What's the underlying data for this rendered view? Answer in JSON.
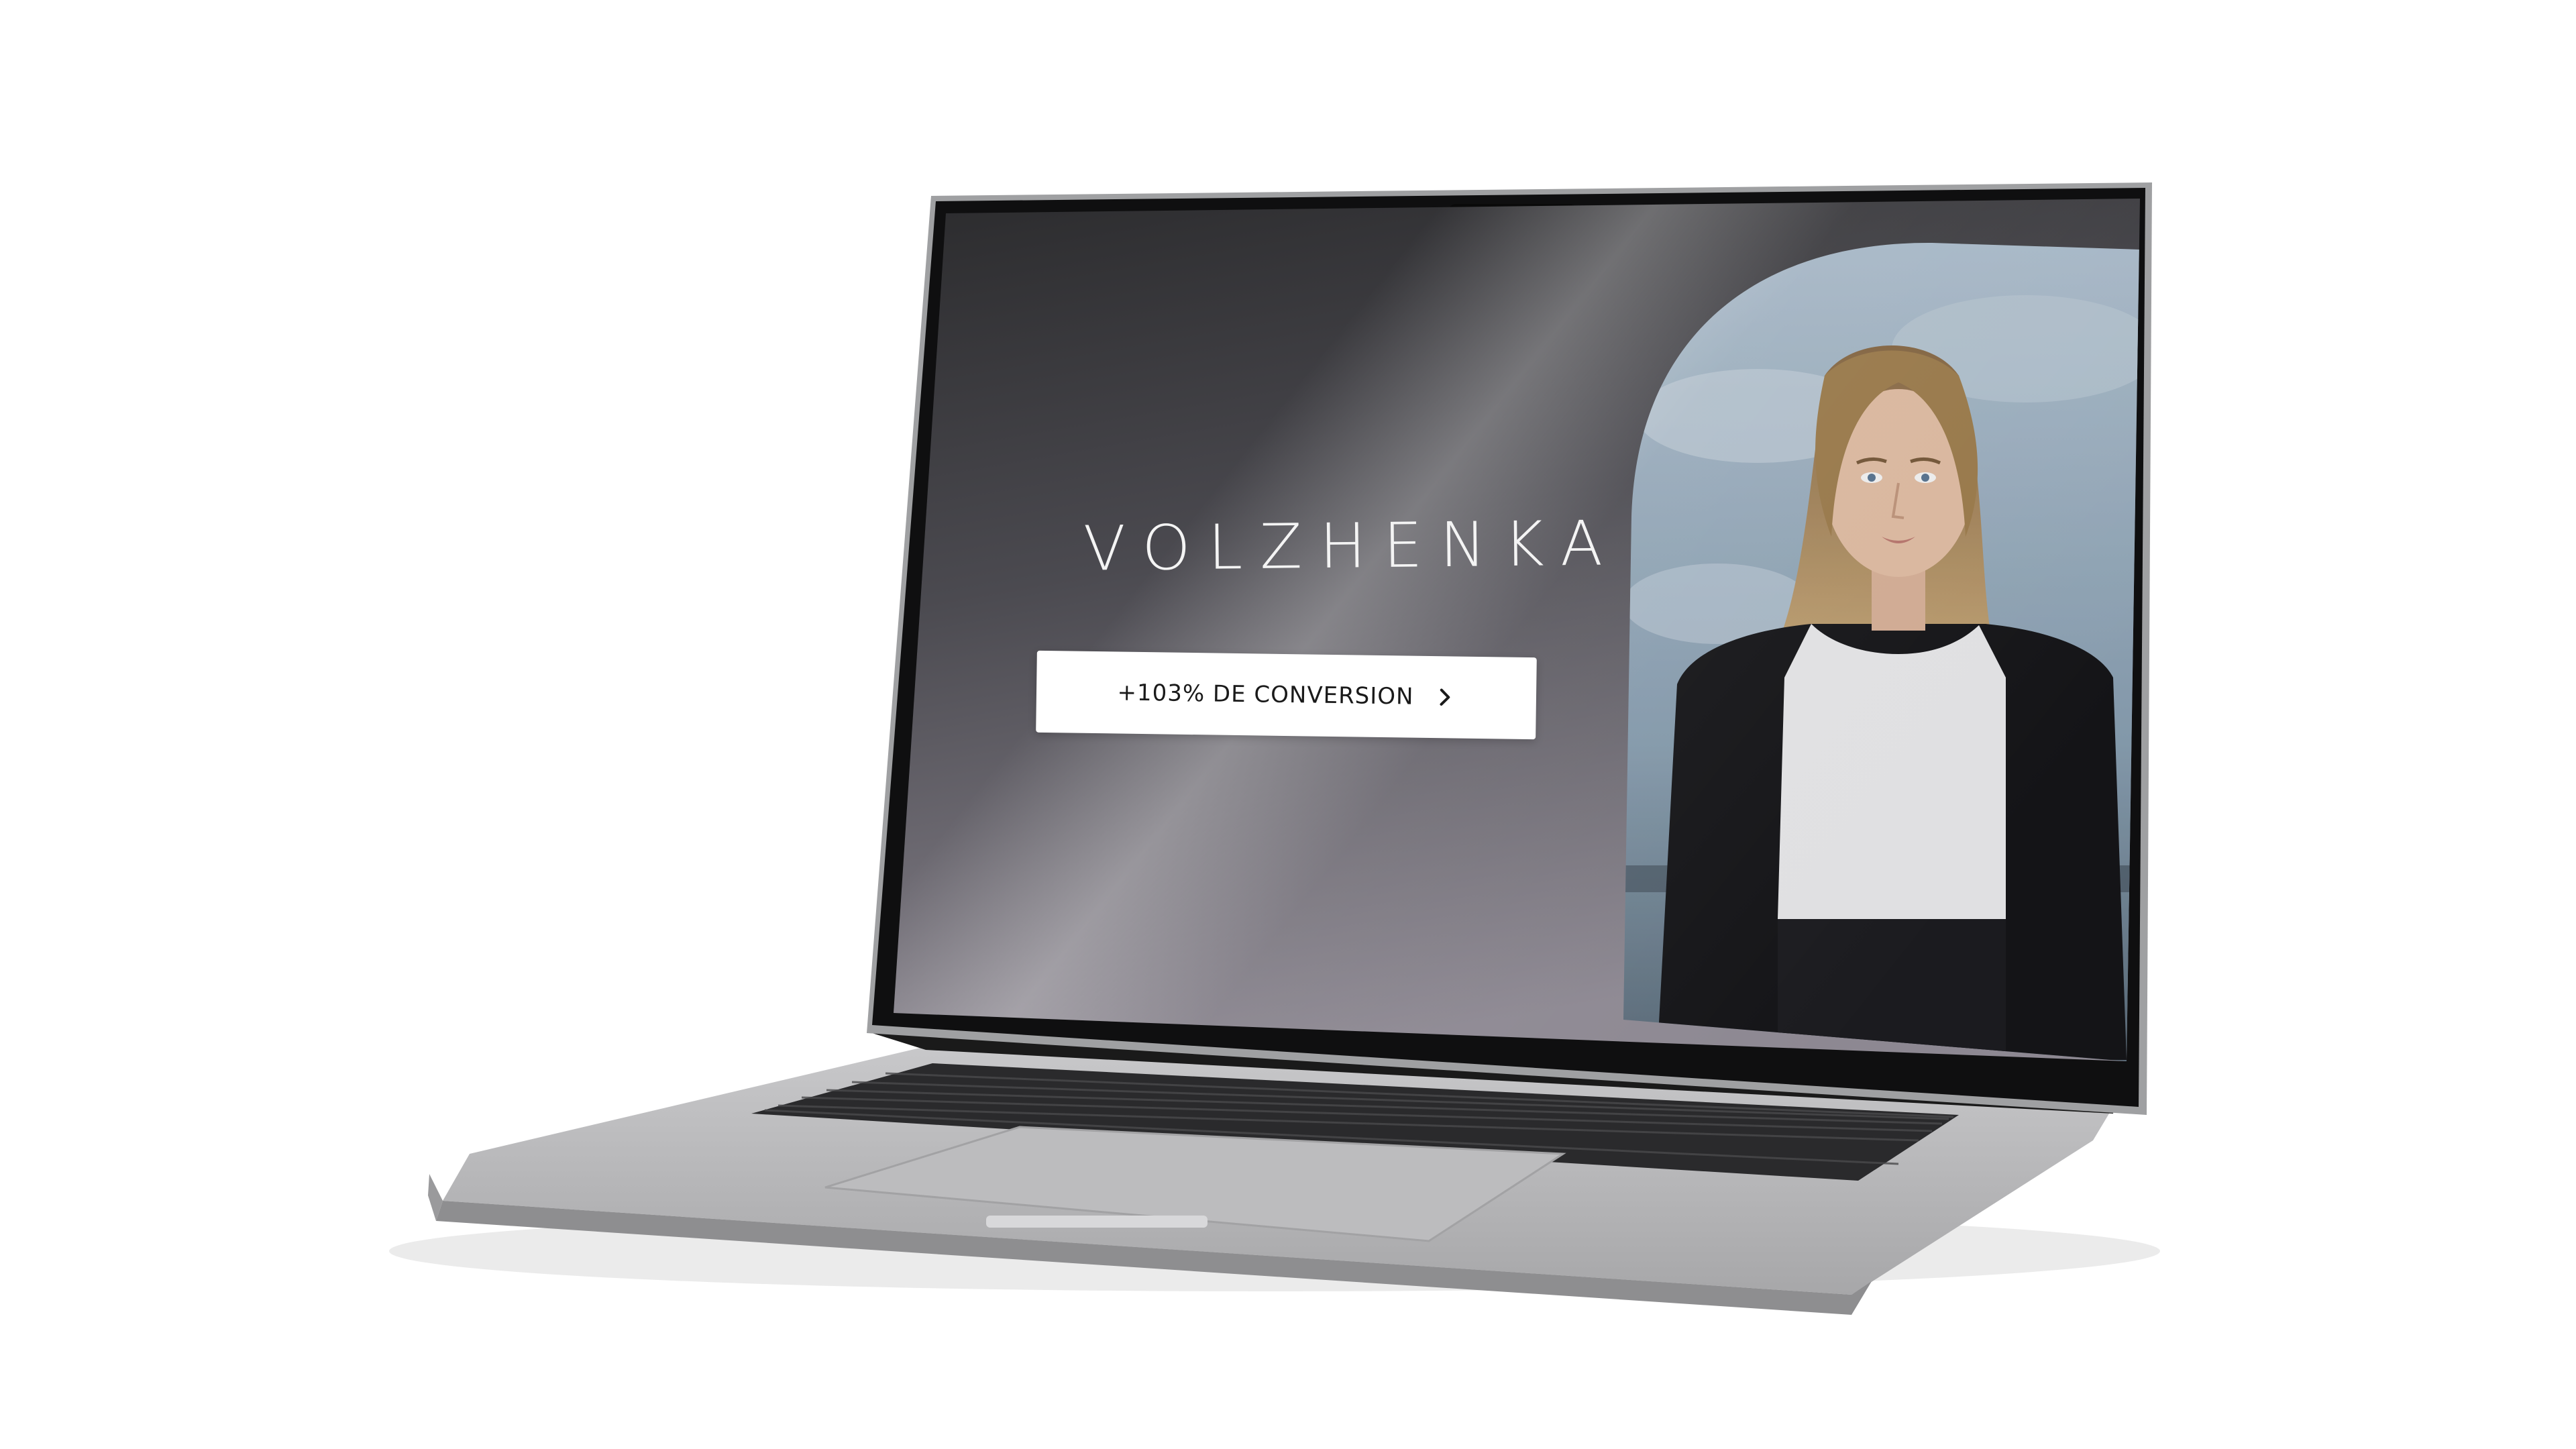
{
  "hero": {
    "brand": "VOLZHENKA",
    "cta_label": "+103% DE CONVERSION",
    "cta_icon": "chevron-right-icon",
    "portrait_icon": "woman-portrait"
  },
  "colors": {
    "screen_dark": "#1c1c1e",
    "screen_gradient_light": "#8a8590",
    "cta_background": "#ffffff",
    "cta_text": "#1a1a1a",
    "laptop_body": "#b5b5b7",
    "sky": "#a9bccd"
  }
}
